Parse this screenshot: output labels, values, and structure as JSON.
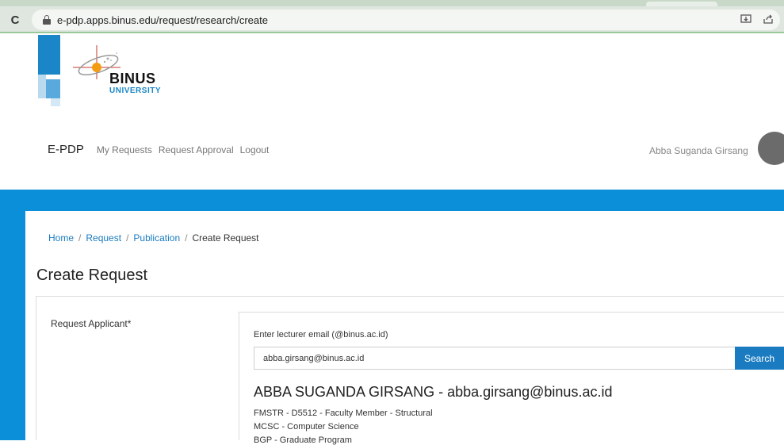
{
  "browser": {
    "url": "e-pdp.apps.binus.edu/request/research/create",
    "reload_icon": "reload-icon",
    "lock_icon": "lock-icon"
  },
  "logo": {
    "brand_name": "BINUS",
    "brand_sub": "UNIVERSITY"
  },
  "nav": {
    "brand": "E-PDP",
    "links": [
      "My Requests",
      "Request Approval",
      "Logout"
    ],
    "user_name": "Abba Suganda Girsang"
  },
  "breadcrumb": {
    "items": [
      "Home",
      "Request",
      "Publication",
      "Create Request"
    ],
    "separator": "/"
  },
  "page": {
    "title": "Create Request"
  },
  "form": {
    "applicant_label": "Request Applicant*",
    "email_label": "Enter lecturer email (@binus.ac.id)",
    "email_value": "abba.girsang@binus.ac.id",
    "search_label": "Search",
    "applicant_name": "ABBA SUGANDA GIRSANG - abba.girsang@binus.ac.id",
    "info_lines": [
      "FMSTR - D5512 - Faculty Member - Structural",
      "MCSC - Computer Science",
      "BGP - Graduate Program"
    ]
  },
  "colors": {
    "accent": "#1a7bc0",
    "banner": "#0b8fd8"
  }
}
